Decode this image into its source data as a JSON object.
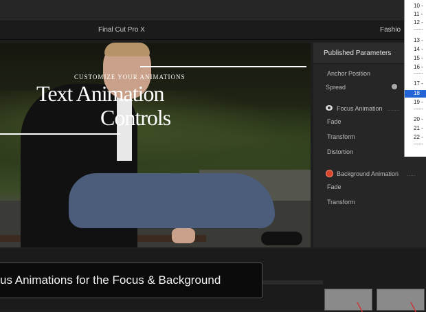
{
  "window": {
    "app_title": "Final Cut Pro X",
    "project_title": "Fashio"
  },
  "viewer": {
    "overlay_subtitle": "CUSTOMIZE YOUR ANIMATIONS",
    "overlay_title_line1": "Text Animation",
    "overlay_title_line2": "Controls"
  },
  "inspector": {
    "title": "Published Parameters",
    "params": {
      "anchor_position": "Anchor Position",
      "spread": "Spread",
      "focus_animation": "Focus Animation",
      "fade_1": "Fade",
      "transform_1": "Transform",
      "distortion": "Distortion",
      "background_animation": "Background Animation",
      "fade_2": "Fade",
      "transform_2": "Transform"
    }
  },
  "dropdown": {
    "items": [
      "10 -",
      "11 -",
      "12 -",
      "13 -",
      "14 -",
      "15 -",
      "16 -",
      "17 -",
      "18",
      "19 -",
      "20 -",
      "21 -",
      "22 -"
    ],
    "selected": "18",
    "separator": "------"
  },
  "caption": {
    "text": "us Animations for the Focus & Background"
  },
  "colors": {
    "selection": "#2165d6",
    "inspector_bg": "#262626",
    "focus_icon": "#dddddd",
    "background_icon": "#d9452b"
  }
}
